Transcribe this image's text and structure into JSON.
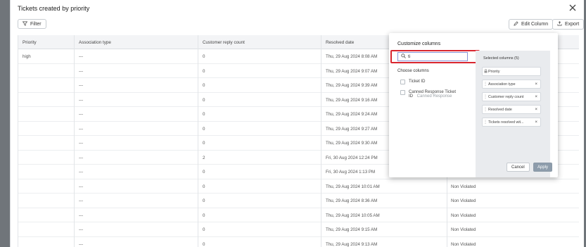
{
  "modal": {
    "title": "Tickets created by priority",
    "filter_label": "Filter",
    "edit_column_label": "Edit Column",
    "export_label": "Export"
  },
  "table": {
    "columns": [
      "Priority",
      "Association type",
      "Customer reply count",
      "Resolved date"
    ],
    "rows": [
      {
        "priority": "high",
        "assoc": "---",
        "replies": "0",
        "resolved": "Thu, 29 Aug 2024 8:08 AM",
        "extra": ""
      },
      {
        "priority": "",
        "assoc": "---",
        "replies": "0",
        "resolved": "Thu, 29 Aug 2024 9:07 AM",
        "extra": ""
      },
      {
        "priority": "",
        "assoc": "---",
        "replies": "0",
        "resolved": "Thu, 29 Aug 2024 9:39 AM",
        "extra": ""
      },
      {
        "priority": "",
        "assoc": "---",
        "replies": "0",
        "resolved": "Thu, 29 Aug 2024 9:16 AM",
        "extra": ""
      },
      {
        "priority": "",
        "assoc": "---",
        "replies": "0",
        "resolved": "Thu, 29 Aug 2024 9:24 AM",
        "extra": ""
      },
      {
        "priority": "",
        "assoc": "---",
        "replies": "0",
        "resolved": "Thu, 29 Aug 2024 9:27 AM",
        "extra": ""
      },
      {
        "priority": "",
        "assoc": "---",
        "replies": "0",
        "resolved": "Thu, 29 Aug 2024 9:30 AM",
        "extra": ""
      },
      {
        "priority": "",
        "assoc": "---",
        "replies": "2",
        "resolved": "Fri, 30 Aug 2024 12:24 PM",
        "extra": ""
      },
      {
        "priority": "",
        "assoc": "---",
        "replies": "0",
        "resolved": "Fri, 30 Aug 2024 1:13 PM",
        "extra": ""
      },
      {
        "priority": "",
        "assoc": "---",
        "replies": "0",
        "resolved": "Thu, 29 Aug 2024 10:01 AM",
        "extra": "Non Violated"
      },
      {
        "priority": "",
        "assoc": "---",
        "replies": "0",
        "resolved": "Thu, 29 Aug 2024 8:36 AM",
        "extra": "Non Violated"
      },
      {
        "priority": "",
        "assoc": "---",
        "replies": "0",
        "resolved": "Thu, 29 Aug 2024 10:05 AM",
        "extra": "Non Violated"
      },
      {
        "priority": "",
        "assoc": "---",
        "replies": "0",
        "resolved": "Thu, 29 Aug 2024 9:15 AM",
        "extra": "Non Violated"
      },
      {
        "priority": "",
        "assoc": "---",
        "replies": "0",
        "resolved": "Thu, 29 Aug 2024 9:13 AM",
        "extra": "Non Violated"
      }
    ]
  },
  "customize": {
    "title": "Customize columns",
    "search_value": "ti",
    "choose_label": "Choose columns",
    "options": [
      {
        "label": "Ticket ID",
        "sub": ""
      },
      {
        "label": "Canned Response Ticket",
        "sub_main": "ID",
        "sub": "Canned Response"
      }
    ],
    "selected_title": "Selected columns (5)",
    "selected": [
      {
        "label": "Priority",
        "removable": false
      },
      {
        "label": "Association type",
        "removable": true
      },
      {
        "label": "Customer reply count",
        "removable": true
      },
      {
        "label": "Resolved date",
        "removable": true
      },
      {
        "label": "Tickets resolved wit...",
        "removable": true
      }
    ],
    "cancel_label": "Cancel",
    "apply_label": "Apply"
  }
}
